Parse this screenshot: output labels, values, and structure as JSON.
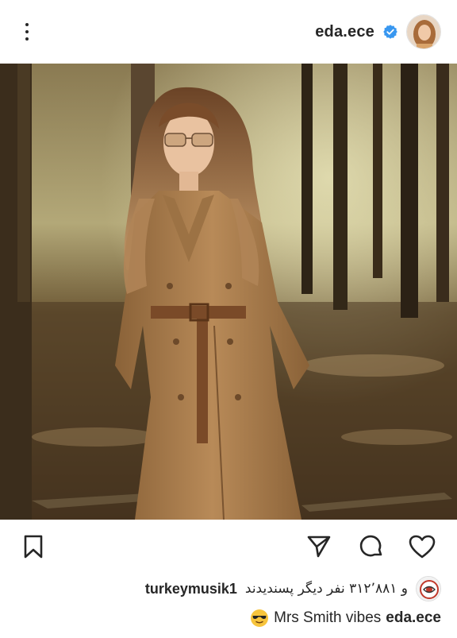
{
  "header": {
    "more_icon": "more-vertical-icon",
    "username": "eda.ece",
    "verified_icon": "verified-badge-icon"
  },
  "post": {
    "image_description_icon": "post-photo"
  },
  "actions": {
    "save_icon": "bookmark-icon",
    "share_icon": "send-icon",
    "comment_icon": "comment-icon",
    "like_icon": "heart-icon"
  },
  "likes": {
    "username": "turkeymusik1",
    "text": "و ۳۱۲٬۸۸۱ نفر دیگر پسندیدند"
  },
  "caption": {
    "username": "eda.ece",
    "text": "Mrs Smith vibes"
  },
  "colors": {
    "text": "#262626",
    "verified_blue": "#3897f0",
    "background": "#ffffff"
  }
}
